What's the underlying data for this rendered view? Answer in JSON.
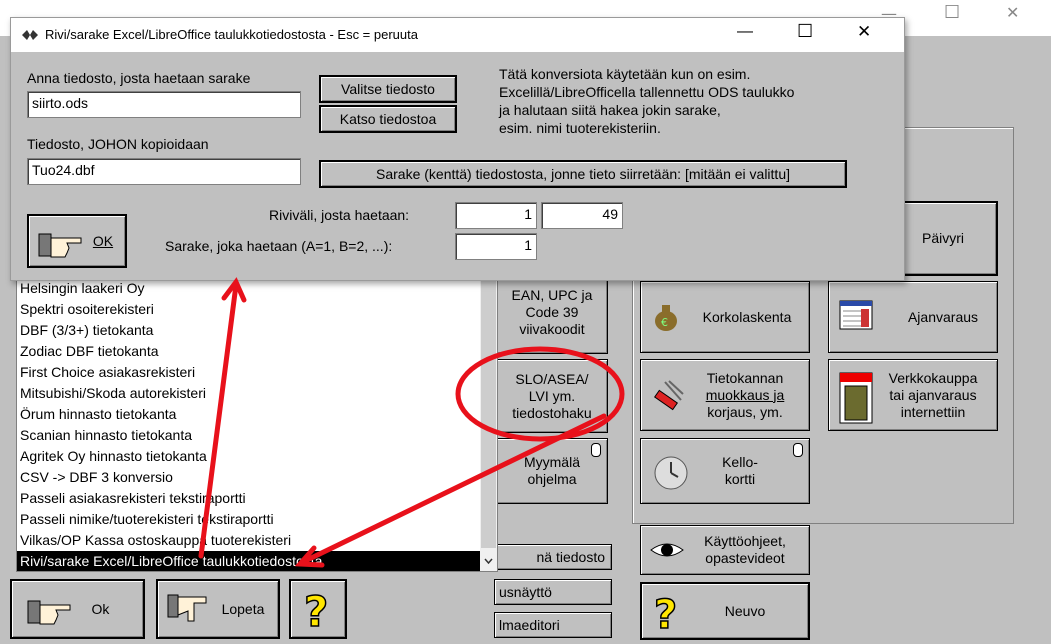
{
  "background": {
    "controls": [
      "—",
      "☐",
      "✕"
    ],
    "panel_buttons": {
      "paivyri": "Päivyri",
      "ean_lines": [
        "EAN, UPC ja",
        "Code 39",
        "viivakoodit"
      ],
      "slo_lines": [
        "SLO/ASEA/",
        "LVI ym.",
        "tiedostohaku"
      ],
      "myymala_lines": [
        "Myymälä",
        "ohjelma"
      ],
      "korkolaskenta": "Korkolaskenta",
      "ajanvaraus": "Ajanvaraus",
      "tietokannan_lines": [
        "Tietokannan",
        "muokkaus ja",
        "korjaus, ym."
      ],
      "verkkokauppa_lines": [
        "Verkkokauppa",
        "tai ajanvaraus",
        "internettiin"
      ],
      "kellokortti_lines": [
        "Kello-",
        "kortti"
      ],
      "kayttoohjeet_lines": [
        "Käyttöohjeet,",
        "opastevideot"
      ],
      "neuvo": "Neuvo",
      "nayta_tiedosto": "nä tiedosto",
      "kokonaisnaytto": "usnäyttö",
      "kuvaeditori": "lmaeditori"
    },
    "list": {
      "items": [
        "Helsingin laakeri Oy",
        "Spektri osoiterekisteri",
        "DBF (3/3+) tietokanta",
        "Zodiac DBF tietokanta",
        "First Choice asiakasrekisteri",
        "Mitsubishi/Skoda autorekisteri",
        "Örum hinnasto tietokanta",
        "Scanian hinnasto tietokanta",
        "Agritek Oy hinnasto tietokanta",
        "CSV -> DBF 3 konversio",
        "Passeli asiakasrekisteri tekstiraportti",
        "Passeli nimike/tuoterekisteri tekstiraportti",
        "Vilkas/OP Kassa ostoskauppa tuoterekisteri",
        "Rivi/sarake Excel/LibreOffice taulukkotiedostosta"
      ],
      "selected_index": 13
    },
    "ok_label": "Ok",
    "lopeta_label": "Lopeta"
  },
  "dialog": {
    "title": "Rivi/sarake Excel/LibreOffice taulukkotiedostosta - Esc = peruuta",
    "controls": [
      "—",
      "☐",
      "✕"
    ],
    "source_label": "Anna tiedosto, josta haetaan sarake",
    "source_value": "siirto.ods",
    "valitse_label": "Valitse tiedosto",
    "katso_label": "Katso tiedostoa",
    "info_lines": [
      "Tätä konversiota käytetään kun on esim.",
      "Excelillä/LibreOfficella tallennettu ODS taulukko",
      "ja halutaan siitä hakea jokin sarake,",
      "esim. nimi tuoterekisteriin."
    ],
    "target_label": "Tiedosto, JOHON kopioidaan",
    "target_value": "Tuo24.dbf",
    "sarake_button": "Sarake (kenttä) tiedostosta, jonne tieto siirretään: [mitään ei valittu]",
    "rivivali_label": "Riviväli, josta haetaan:",
    "rivi_from": "1",
    "rivi_to": "49",
    "sarake_label": "Sarake, joka haetaan (A=1, B=2, ...):",
    "sarake_value": "1",
    "ok_label": "OK"
  },
  "colors": {
    "annotation_red": "#e8111b",
    "selection": "#000000",
    "window_bg": "#c0c0c0"
  }
}
